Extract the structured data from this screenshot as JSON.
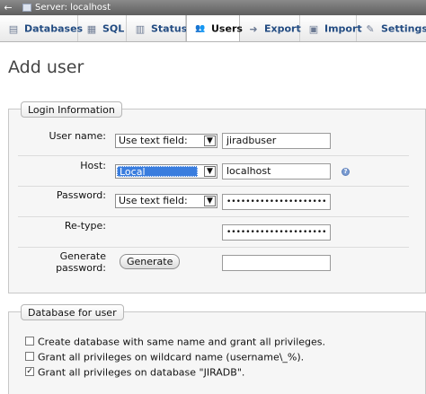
{
  "titlebar": {
    "back_glyph": "←",
    "title": "Server: localhost"
  },
  "tabs": [
    {
      "label": "Databases",
      "icon": "database-icon",
      "glyph": "▤"
    },
    {
      "label": "SQL",
      "icon": "sql-icon",
      "glyph": "▦"
    },
    {
      "label": "Status",
      "icon": "status-icon",
      "glyph": "▥"
    },
    {
      "label": "Users",
      "icon": "users-icon",
      "glyph": "👥",
      "active": true
    },
    {
      "label": "Export",
      "icon": "export-icon",
      "glyph": "➜"
    },
    {
      "label": "Import",
      "icon": "import-icon",
      "glyph": "▣"
    },
    {
      "label": "Settings",
      "icon": "settings-icon",
      "glyph": "✎"
    }
  ],
  "page": {
    "title": "Add user"
  },
  "login": {
    "legend": "Login Information",
    "username": {
      "label": "User name:",
      "select": "Use text field:",
      "value": "jiradbuser"
    },
    "host": {
      "label": "Host:",
      "select": "Local",
      "value": "localhost"
    },
    "password": {
      "label": "Password:",
      "select": "Use text field:",
      "value": "•••••••••••••••••••••"
    },
    "retype": {
      "label": "Re-type:",
      "value": "•••••••••••••••••••••"
    },
    "generate": {
      "label": "Generate password:",
      "button": "Generate",
      "value": ""
    },
    "dropdown_arrow": "▼",
    "help_glyph": "?"
  },
  "database": {
    "legend": "Database for user",
    "options": [
      {
        "label": "Create database with same name and grant all privileges.",
        "checked": false
      },
      {
        "label": "Grant all privileges on wildcard name (username\\_%).",
        "checked": false
      },
      {
        "label": "Grant all privileges on database \"JIRADB\".",
        "checked": true
      }
    ],
    "check_glyph": "✓"
  }
}
